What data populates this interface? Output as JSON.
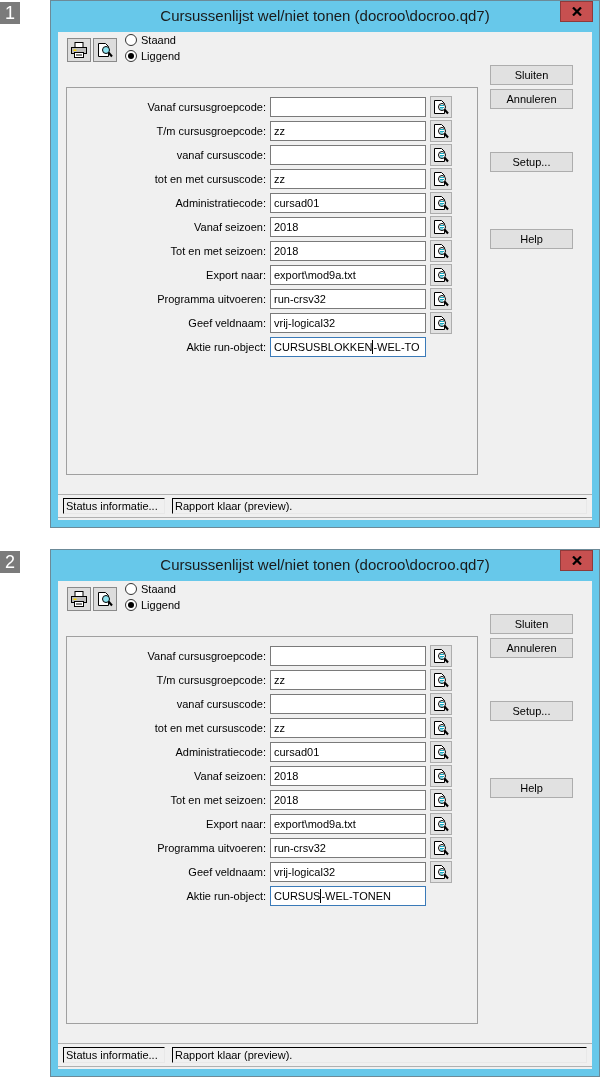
{
  "steps": [
    {
      "number": "1",
      "window": {
        "title": "Cursussenlijst wel/niet tonen (docroo\\docroo.qd7)",
        "orientation": [
          {
            "label": "Staand",
            "selected": false
          },
          {
            "label": "Liggend",
            "selected": true
          }
        ],
        "side_buttons": [
          "Sluiten",
          "Annuleren",
          "Setup...",
          "Help"
        ],
        "fields": [
          {
            "label": "Vanaf cursusgroepcode:",
            "lookup": true,
            "focused": false
          },
          {
            "label": "T/m cursusgroepcode:",
            "value": "zz",
            "lookup": true,
            "focused": false
          },
          {
            "label": "vanaf cursuscode:",
            "lookup": true,
            "focused": false
          },
          {
            "label": "tot en met cursuscode:",
            "value": "zz",
            "lookup": true,
            "focused": false
          },
          {
            "label": "Administratiecode:",
            "value": "cursad01",
            "lookup": true,
            "focused": false
          },
          {
            "label": "Vanaf seizoen:",
            "value": "2018",
            "lookup": true,
            "focused": false
          },
          {
            "label": "Tot en met seizoen:",
            "value": "2018",
            "lookup": true,
            "focused": false
          },
          {
            "label": "Export naar:",
            "value": "export\\mod9a.txt",
            "lookup": true,
            "focused": false
          },
          {
            "label": "Programma uitvoeren:",
            "value": "run-crsv32",
            "lookup": true,
            "focused": false
          },
          {
            "label": "Geef veldnaam:",
            "value": "vrij-logical32",
            "lookup": true,
            "focused": false
          },
          {
            "label": "Aktie run-object:",
            "value": "CURSUSBLOKKEN",
            "value_after_caret": "-WEL-TO",
            "lookup": false,
            "focused": true
          }
        ],
        "status_bar": [
          "Status informatie...",
          "Rapport klaar (preview)."
        ]
      }
    },
    {
      "number": "2",
      "window": {
        "title": "Cursussenlijst wel/niet tonen (docroo\\docroo.qd7)",
        "orientation": [
          {
            "label": "Staand",
            "selected": false
          },
          {
            "label": "Liggend",
            "selected": true
          }
        ],
        "side_buttons": [
          "Sluiten",
          "Annuleren",
          "Setup...",
          "Help"
        ],
        "fields": [
          {
            "label": "Vanaf cursusgroepcode:",
            "lookup": true,
            "focused": false
          },
          {
            "label": "T/m cursusgroepcode:",
            "value": "zz",
            "lookup": true,
            "focused": false
          },
          {
            "label": "vanaf cursuscode:",
            "lookup": true,
            "focused": false
          },
          {
            "label": "tot en met cursuscode:",
            "value": "zz",
            "lookup": true,
            "focused": false
          },
          {
            "label": "Administratiecode:",
            "value": "cursad01",
            "lookup": true,
            "focused": false
          },
          {
            "label": "Vanaf seizoen:",
            "value": "2018",
            "lookup": true,
            "focused": false
          },
          {
            "label": "Tot en met seizoen:",
            "value": "2018",
            "lookup": true,
            "focused": false
          },
          {
            "label": "Export naar:",
            "value": "export\\mod9a.txt",
            "lookup": true,
            "focused": false
          },
          {
            "label": "Programma uitvoeren:",
            "value": "run-crsv32",
            "lookup": true,
            "focused": false
          },
          {
            "label": "Geef veldnaam:",
            "value": "vrij-logical32",
            "lookup": true,
            "focused": false
          },
          {
            "label": "Aktie run-object:",
            "value": "CURSUS",
            "value_after_caret": "-WEL-TONEN",
            "lookup": false,
            "focused": true
          }
        ],
        "status_bar": [
          "Status informatie...",
          "Rapport klaar (preview)."
        ]
      }
    }
  ]
}
